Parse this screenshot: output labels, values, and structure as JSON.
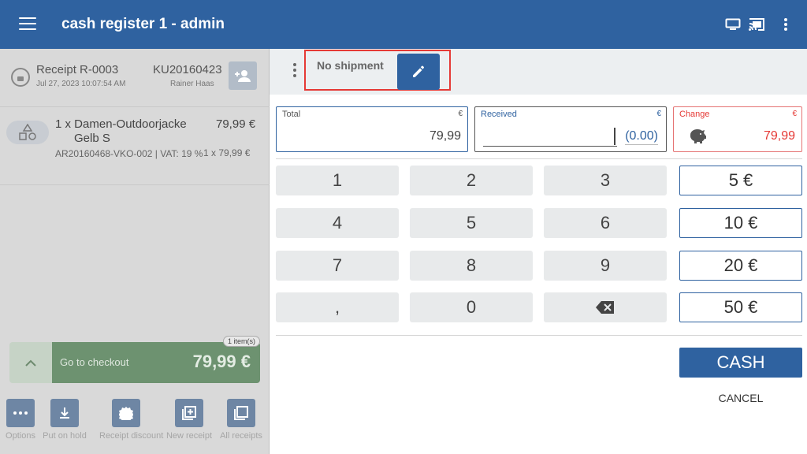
{
  "app": {
    "title": "cash register 1 - admin"
  },
  "receipt": {
    "number": "Receipt R-0003",
    "date": "Jul 27, 2023 10:07:54 AM",
    "customer_id": "KU20160423",
    "customer_name": "Rainer Haas"
  },
  "item": {
    "title_line1": "1 x Damen-Outdoorjacke",
    "title_line2": "Gelb S",
    "price": "79,99 €",
    "sku": "AR20160468-VKO-002 | VAT: 19 %",
    "unit": "1 x 79,99 €"
  },
  "checkout": {
    "label": "Go to checkout",
    "total": "79,99 €",
    "badge": "1 item(s)"
  },
  "actions": [
    {
      "label": "Options"
    },
    {
      "label": "Put on hold"
    },
    {
      "label": "Receipt discount"
    },
    {
      "label": "New receipt"
    },
    {
      "label": "All receipts"
    }
  ],
  "shipment": {
    "label": "No shipment"
  },
  "fields": {
    "total": {
      "label": "Total",
      "currency": "€",
      "value": "79,99"
    },
    "received": {
      "label": "Received",
      "currency": "€",
      "value": "(0.00)"
    },
    "change": {
      "label": "Change",
      "currency": "€",
      "value": "79,99"
    }
  },
  "keypad": {
    "k1": "1",
    "k2": "2",
    "k3": "3",
    "k4": "4",
    "k5": "5",
    "k6": "6",
    "k7": "7",
    "k8": "8",
    "k9": "9",
    "comma": ",",
    "k0": "0"
  },
  "quick_amounts": [
    "5 €",
    "10 €",
    "20 €",
    "50 €"
  ],
  "buttons": {
    "cash": "CASH",
    "cancel": "CANCEL"
  },
  "colors": {
    "primary": "#2f62a0",
    "change": "#e53935",
    "checkout": "#6d9270"
  }
}
